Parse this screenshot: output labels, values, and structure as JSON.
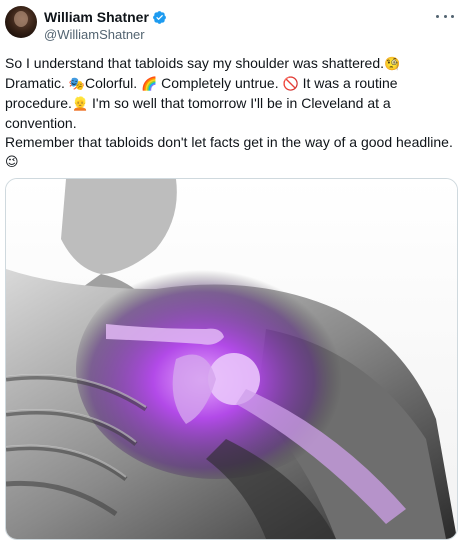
{
  "author": {
    "display_name": "William Shatner",
    "handle": "@WilliamShatner",
    "verified": true,
    "avatar_icon": "profile-photo"
  },
  "menu": {
    "more_icon": "ellipsis-icon"
  },
  "tweet": {
    "line1_text": "So I understand that tabloids say my shoulder was shattered.",
    "line1_emoji": "🧐",
    "line2_a": "Dramatic. ",
    "line2_emoji1": "🎭",
    "line2_b": "Colorful. ",
    "line2_emoji2": "🌈",
    "line2_c": " Completely untrue. ",
    "line2_emoji3": "🚫",
    "line2_d": " It was a routine procedure.",
    "line2_emoji4": "👱",
    "line2_e": " I'm so well that tomorrow I'll be in Cleveland at a convention.",
    "line3_text": "Remember that tabloids don't let facts get in the way of a good headline.",
    "line3_emoji": "😉"
  },
  "colors": {
    "verified_blue": "#1d9bf0",
    "text_primary": "#0f1419",
    "text_secondary": "#536471",
    "joint_highlight": "#b84df0"
  }
}
